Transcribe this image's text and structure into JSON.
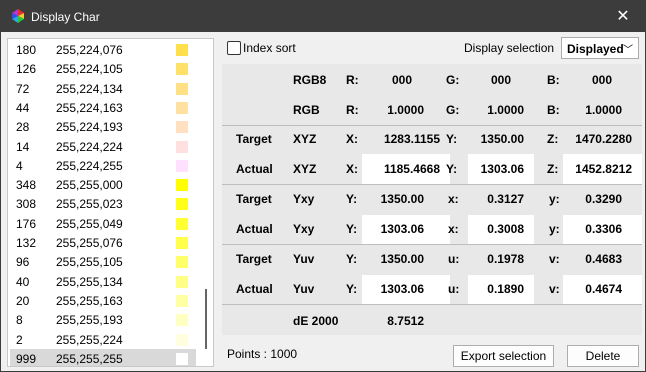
{
  "window": {
    "title": "Display Char",
    "app_icon": "color-wheel-icon",
    "close_icon": "close-icon"
  },
  "list": {
    "rows": [
      {
        "idx": "180",
        "rgb": "255,224,076",
        "color": "#ffe04c"
      },
      {
        "idx": "126",
        "rgb": "255,224,105",
        "color": "#ffe069"
      },
      {
        "idx": "72",
        "rgb": "255,224,134",
        "color": "#ffe086"
      },
      {
        "idx": "44",
        "rgb": "255,224,163",
        "color": "#ffe0a3"
      },
      {
        "idx": "28",
        "rgb": "255,224,193",
        "color": "#ffe0c1"
      },
      {
        "idx": "14",
        "rgb": "255,224,224",
        "color": "#ffe0e0"
      },
      {
        "idx": "4",
        "rgb": "255,224,255",
        "color": "#ffe0ff"
      },
      {
        "idx": "348",
        "rgb": "255,255,000",
        "color": "#ffff00"
      },
      {
        "idx": "308",
        "rgb": "255,255,023",
        "color": "#ffff17"
      },
      {
        "idx": "176",
        "rgb": "255,255,049",
        "color": "#ffff31"
      },
      {
        "idx": "132",
        "rgb": "255,255,076",
        "color": "#ffff4c"
      },
      {
        "idx": "96",
        "rgb": "255,255,105",
        "color": "#ffff69"
      },
      {
        "idx": "40",
        "rgb": "255,255,134",
        "color": "#ffff86"
      },
      {
        "idx": "20",
        "rgb": "255,255,163",
        "color": "#ffffa3"
      },
      {
        "idx": "8",
        "rgb": "255,255,193",
        "color": "#ffffc1"
      },
      {
        "idx": "2",
        "rgb": "255,255,224",
        "color": "#ffffe0"
      },
      {
        "idx": "999",
        "rgb": "255,255,255",
        "color": "#ffffff",
        "selected": true
      }
    ]
  },
  "topbar": {
    "index_sort_label": "Index sort",
    "display_selection_label": "Display selection",
    "display_selection_value": "Displayed"
  },
  "table": {
    "rgb8": {
      "label": "RGB8",
      "r_label": "R:",
      "r": "000",
      "g_label": "G:",
      "g": "000",
      "b_label": "B:",
      "b": "000"
    },
    "rgb": {
      "label": "RGB",
      "r_label": "R:",
      "r": "1.0000",
      "g_label": "G:",
      "g": "1.0000",
      "b_label": "B:",
      "b": "1.0000"
    },
    "target_xyz": {
      "row_label": "Target",
      "label": "XYZ",
      "a_label": "X:",
      "a": "1283.1155",
      "b_label": "Y:",
      "b": "1350.00",
      "c_label": "Z:",
      "c": "1470.2280"
    },
    "actual_xyz": {
      "row_label": "Actual",
      "label": "XYZ",
      "a_label": "X:",
      "a": "1185.4668",
      "b_label": "Y:",
      "b": "1303.06",
      "c_label": "Z:",
      "c": "1452.8212"
    },
    "target_yxy": {
      "row_label": "Target",
      "label": "Yxy",
      "a_label": "Y:",
      "a": "1350.00",
      "b_label": "x:",
      "b": "0.3127",
      "c_label": "y:",
      "c": "0.3290"
    },
    "actual_yxy": {
      "row_label": "Actual",
      "label": "Yxy",
      "a_label": "Y:",
      "a": "1303.06",
      "b_label": "x:",
      "b": "0.3008",
      "c_label": "y:",
      "c": "0.3306"
    },
    "target_yuv": {
      "row_label": "Target",
      "label": "Yuv",
      "a_label": "Y:",
      "a": "1350.00",
      "b_label": "u:",
      "b": "0.1978",
      "c_label": "v:",
      "c": "0.4683"
    },
    "actual_yuv": {
      "row_label": "Actual",
      "label": "Yuv",
      "a_label": "Y:",
      "a": "1303.06",
      "b_label": "u:",
      "b": "0.1890",
      "c_label": "v:",
      "c": "0.4674"
    },
    "de": {
      "label": "dE 2000",
      "value": "8.7512"
    }
  },
  "footer": {
    "points": "Points : 1000",
    "export_label": "Export selection",
    "delete_label": "Delete"
  }
}
